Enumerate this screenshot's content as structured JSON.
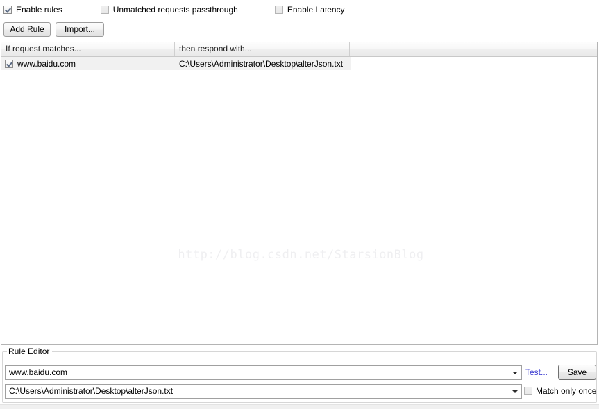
{
  "options": {
    "items": [
      {
        "name": "enable-rules",
        "label": "Enable rules",
        "checked": true
      },
      {
        "name": "unmatched-passthrough",
        "label": "Unmatched requests passthrough",
        "checked": false
      },
      {
        "name": "enable-latency",
        "label": "Enable Latency",
        "checked": false
      }
    ]
  },
  "toolbar": {
    "add_rule_label": "Add Rule",
    "import_label": "Import..."
  },
  "table": {
    "columns": [
      {
        "name": "if-request-matches",
        "label": "If request matches..."
      },
      {
        "name": "then-respond-with",
        "label": "then respond with..."
      },
      {
        "name": "extra-column",
        "label": ""
      }
    ],
    "rows": [
      {
        "enabled": true,
        "match": "www.baidu.com",
        "respond": "C:\\Users\\Administrator\\Desktop\\alterJson.txt"
      }
    ]
  },
  "watermark": {
    "text": "http://blog.csdn.net/StarsionBlog"
  },
  "rule_editor": {
    "group_label": "Rule Editor",
    "match_value": "www.baidu.com",
    "respond_value": "C:\\Users\\Administrator\\Desktop\\alterJson.txt",
    "test_label": "Test...",
    "save_label": "Save",
    "match_only_once_label": "Match only once",
    "match_only_once_checked": false
  },
  "colors": {
    "link": "#3a3ad0",
    "row_selected": "#f1f1f1",
    "watermark": "#efeff1"
  }
}
